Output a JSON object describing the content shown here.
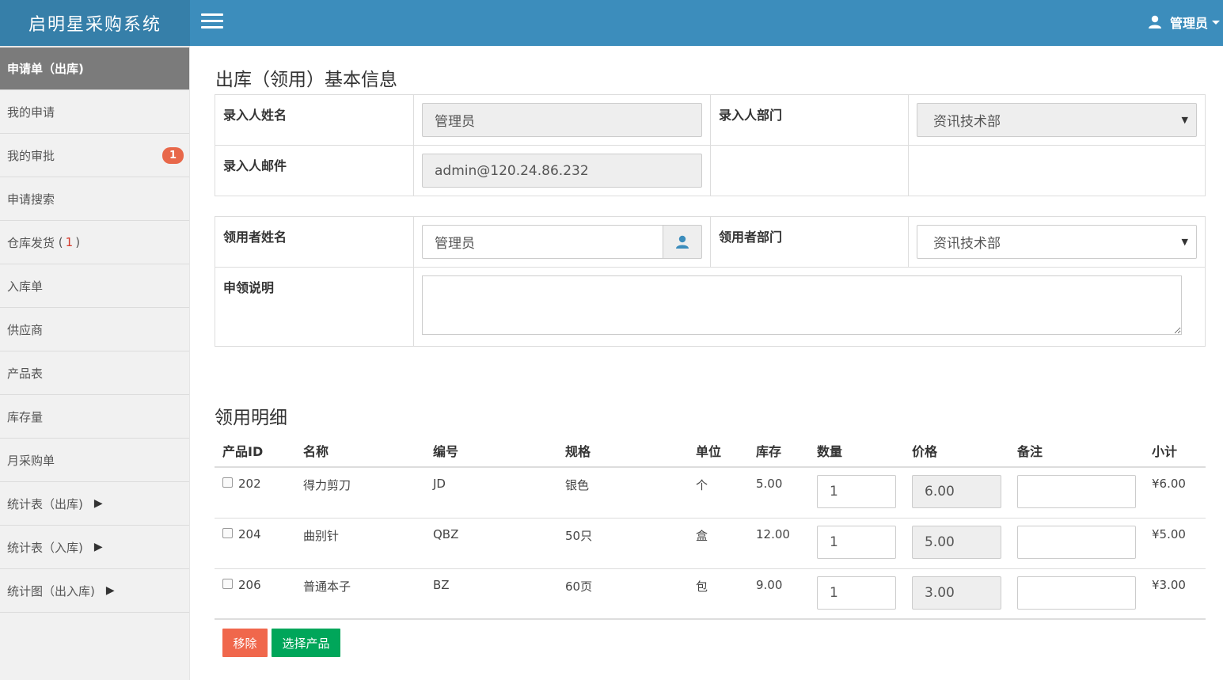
{
  "header": {
    "brand": "启明星采购系统",
    "user": "管理员"
  },
  "sidebar": {
    "items": [
      {
        "label": "申请单（出库)"
      },
      {
        "label": "我的申请"
      },
      {
        "label": "我的审批",
        "badge": "1"
      },
      {
        "label": "申请搜索"
      },
      {
        "label": "仓库发货",
        "count": "1"
      },
      {
        "label": "入库单"
      },
      {
        "label": "供应商"
      },
      {
        "label": "产品表"
      },
      {
        "label": "库存量"
      },
      {
        "label": "月采购单"
      },
      {
        "label": "统计表（出库)"
      },
      {
        "label": "统计表（入库)"
      },
      {
        "label": "统计图（出入库)"
      }
    ]
  },
  "basic": {
    "title": "出库（领用）基本信息",
    "entry_name_label": "录入人姓名",
    "entry_name_value": "管理员",
    "entry_dept_label": "录入人部门",
    "entry_dept_value": "资讯技术部",
    "entry_email_label": "录入人邮件",
    "entry_email_value": "admin@120.24.86.232",
    "receiver_name_label": "领用者姓名",
    "receiver_name_value": "管理员",
    "receiver_dept_label": "领用者部门",
    "receiver_dept_value": "资讯技术部",
    "note_label": "申领说明",
    "note_value": ""
  },
  "details": {
    "title": "领用明细",
    "columns": [
      "产品ID",
      "名称",
      "编号",
      "规格",
      "单位",
      "库存",
      "数量",
      "价格",
      "备注",
      "小计"
    ],
    "rows": [
      {
        "id": "202",
        "name": "得力剪刀",
        "code": "JD",
        "spec": "银色",
        "unit": "个",
        "stock": "5.00",
        "qty": "1",
        "price": "6.00",
        "remark": "",
        "subtotal": "¥6.00"
      },
      {
        "id": "204",
        "name": "曲别针",
        "code": "QBZ",
        "spec": "50只",
        "unit": "盒",
        "stock": "12.00",
        "qty": "1",
        "price": "5.00",
        "remark": "",
        "subtotal": "¥5.00"
      },
      {
        "id": "206",
        "name": "普通本子",
        "code": "BZ",
        "spec": "60页",
        "unit": "包",
        "stock": "9.00",
        "qty": "1",
        "price": "3.00",
        "remark": "",
        "subtotal": "¥3.00"
      }
    ]
  },
  "actions": {
    "remove": "移除",
    "select_product": "选择产品"
  },
  "colors": {
    "topbar": "#3c8dbc",
    "brand_bg": "#367fa9",
    "remove_btn": "#f0674c",
    "select_btn": "#00a65a",
    "badge": "#e8684a"
  }
}
